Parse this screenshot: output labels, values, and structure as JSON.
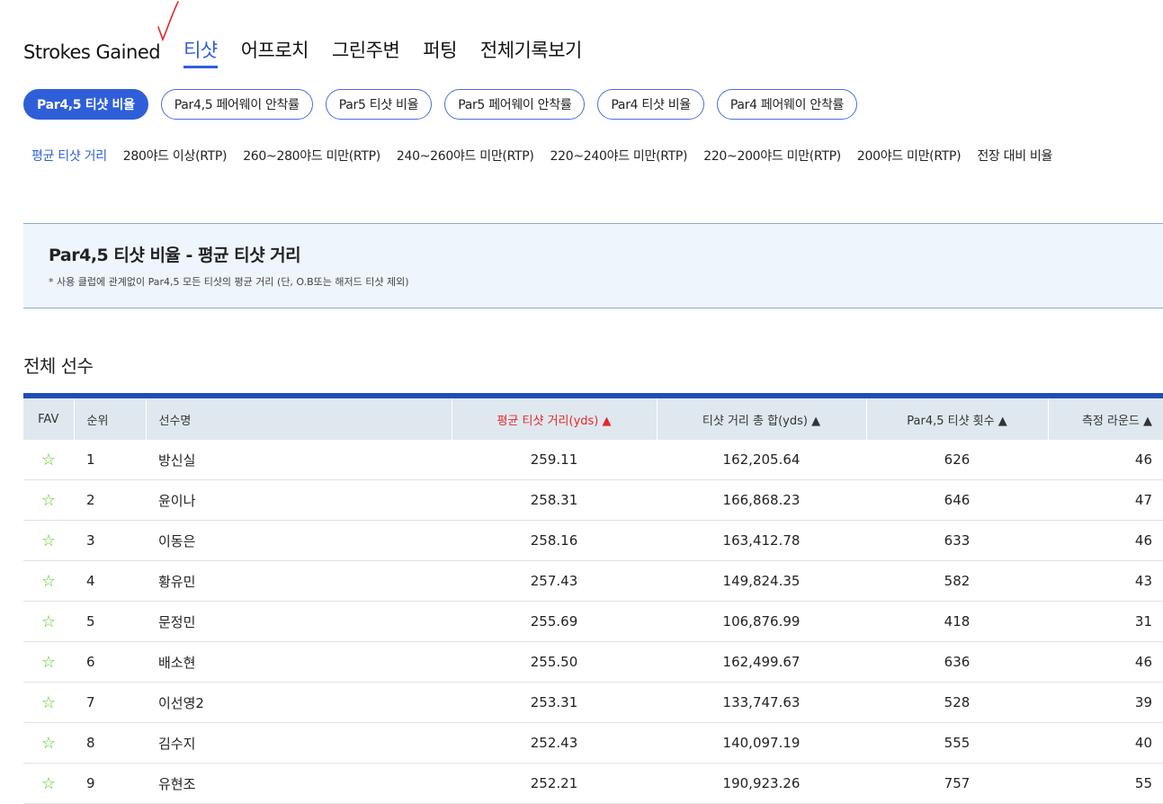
{
  "main_tabs": [
    "Strokes Gained",
    "티샷",
    "어프로치",
    "그린주변",
    "퍼팅",
    "전체기록보기"
  ],
  "pills": [
    "Par4,5 티샷 비율",
    "Par4,5 페어웨이 안착률",
    "Par5 티샷 비율",
    "Par5 페어웨이 안착률",
    "Par4 티샷 비율",
    "Par4 페어웨이 안착률"
  ],
  "subtabs": [
    "평균 티샷 거리",
    "280야드 이상(RTP)",
    "260~280야드 미만(RTP)",
    "240~260야드 미만(RTP)",
    "220~240야드 미만(RTP)",
    "220~200야드 미만(RTP)",
    "200야드 미만(RTP)",
    "전장 대비 비율"
  ],
  "info": {
    "title": "Par4,5 티샷 비율 - 평균 티샷 거리",
    "note": "* 사용 클럽에 관계없이 Par4,5 모든 티샷의 평균 거리 (단, O.B또는 해저드 티샷 제외)"
  },
  "section_title": "전체 선수",
  "table": {
    "headers": [
      "FAV",
      "순위",
      "선수명",
      "평균 티샷 거리(yds) ▲",
      "티샷 거리 총 합(yds) ▲",
      "Par4,5 티샷 횟수 ▲",
      "측정 라운드 ▲"
    ],
    "rows": [
      [
        "☆",
        "1",
        "방신실",
        "259.11",
        "162,205.64",
        "626",
        "46"
      ],
      [
        "☆",
        "2",
        "윤이나",
        "258.31",
        "166,868.23",
        "646",
        "47"
      ],
      [
        "☆",
        "3",
        "이동은",
        "258.16",
        "163,412.78",
        "633",
        "46"
      ],
      [
        "☆",
        "4",
        "황유민",
        "257.43",
        "149,824.35",
        "582",
        "43"
      ],
      [
        "☆",
        "5",
        "문정민",
        "255.69",
        "106,876.99",
        "418",
        "31"
      ],
      [
        "☆",
        "6",
        "배소현",
        "255.50",
        "162,499.67",
        "636",
        "46"
      ],
      [
        "☆",
        "7",
        "이선영2",
        "253.31",
        "133,747.63",
        "528",
        "39"
      ],
      [
        "☆",
        "8",
        "김수지",
        "252.43",
        "140,097.19",
        "555",
        "40"
      ],
      [
        "☆",
        "9",
        "유현조",
        "252.21",
        "190,923.26",
        "757",
        "55"
      ]
    ]
  }
}
